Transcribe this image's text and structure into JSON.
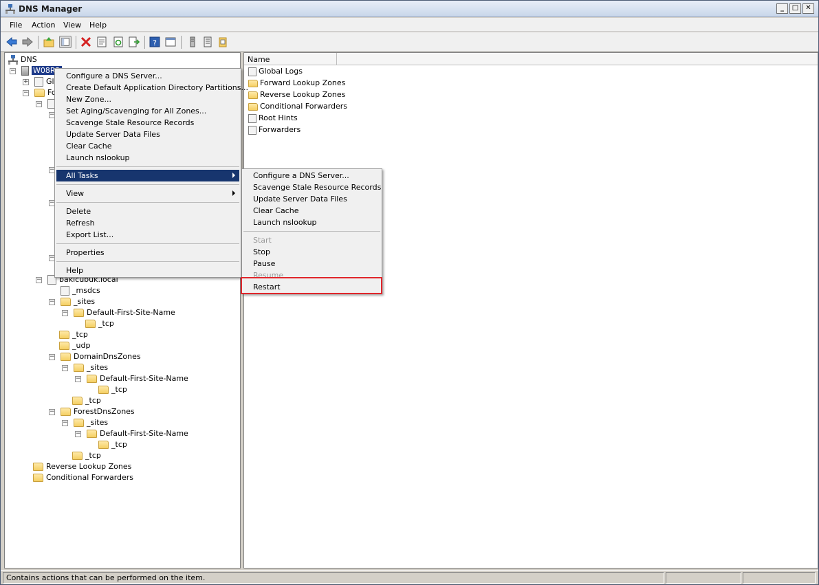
{
  "window": {
    "title": "DNS Manager",
    "minimize": "_",
    "maximize": "□",
    "close": "✕"
  },
  "menu": [
    "File",
    "Action",
    "View",
    "Help"
  ],
  "tree": {
    "root": "DNS",
    "server": "W08R2",
    "global_logs_short": "Gl",
    "forward_short": "Fo",
    "bakicubuk": "bakicubuk.local",
    "msdcs": "_msdcs",
    "sites": "_sites",
    "default_site": "Default-First-Site-Name",
    "tcp": "_tcp",
    "udp": "_udp",
    "domain_dns": "DomainDnsZones",
    "forest_dns": "ForestDnsZones",
    "reverse": "Reverse Lookup Zones",
    "conditional": "Conditional Forwarders"
  },
  "list": {
    "column": "Name",
    "items": [
      "Global Logs",
      "Forward Lookup Zones",
      "Reverse Lookup Zones",
      "Conditional Forwarders",
      "Root Hints",
      "Forwarders"
    ]
  },
  "context_menu": {
    "items": [
      "Configure a DNS Server...",
      "Create Default Application Directory Partitions...",
      "New Zone...",
      "Set Aging/Scavenging for All Zones...",
      "Scavenge Stale Resource Records",
      "Update Server Data Files",
      "Clear Cache",
      "Launch nslookup"
    ],
    "all_tasks": "All Tasks",
    "view": "View",
    "delete": "Delete",
    "refresh": "Refresh",
    "export": "Export List...",
    "properties": "Properties",
    "help": "Help"
  },
  "submenu": {
    "items": [
      "Configure a DNS Server...",
      "Scavenge Stale Resource Records",
      "Update Server Data Files",
      "Clear Cache",
      "Launch nslookup"
    ],
    "start": "Start",
    "stop": "Stop",
    "pause": "Pause",
    "resume": "Resume",
    "restart": "Restart"
  },
  "status": {
    "text": "Contains actions that can be performed on the item."
  },
  "colors": {
    "highlight": "#17356e",
    "restart_box": "#e0262b",
    "folder": "#f5cf63"
  }
}
